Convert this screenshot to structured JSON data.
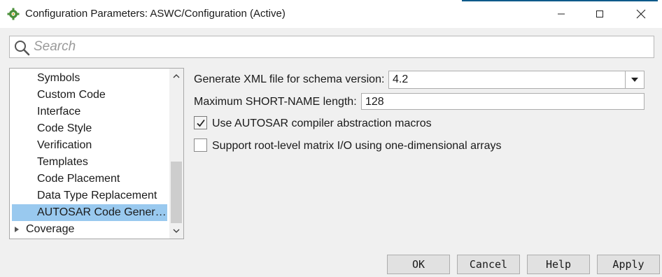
{
  "window": {
    "title": "Configuration Parameters: ASWC/Configuration (Active)",
    "icon": "gear-icon",
    "accent_color": "#0e5a8a"
  },
  "search": {
    "placeholder": "Search",
    "value": ""
  },
  "tree": {
    "items": [
      {
        "label": "Symbols",
        "selected": false
      },
      {
        "label": "Custom Code",
        "selected": false
      },
      {
        "label": "Interface",
        "selected": false
      },
      {
        "label": "Code Style",
        "selected": false
      },
      {
        "label": "Verification",
        "selected": false
      },
      {
        "label": "Templates",
        "selected": false
      },
      {
        "label": "Code Placement",
        "selected": false
      },
      {
        "label": "Data Type Replacement",
        "selected": false
      },
      {
        "label": "AUTOSAR Code Gener…",
        "selected": true
      },
      {
        "label": "Coverage",
        "selected": false,
        "collapsed": true
      }
    ],
    "selection_color": "#99c9ef",
    "scroll_position": 0.6
  },
  "form": {
    "schema_label": "Generate XML file for schema version:",
    "schema_value": "4.2",
    "shortname_label": "Maximum SHORT-NAME length:",
    "shortname_value": "128",
    "compiler_macros_label": "Use AUTOSAR compiler abstraction macros",
    "compiler_macros_checked": true,
    "matrix_io_label": "Support root-level matrix I/O using one-dimensional arrays",
    "matrix_io_checked": false
  },
  "buttons": {
    "ok": "OK",
    "cancel": "Cancel",
    "help": "Help",
    "apply": "Apply"
  }
}
